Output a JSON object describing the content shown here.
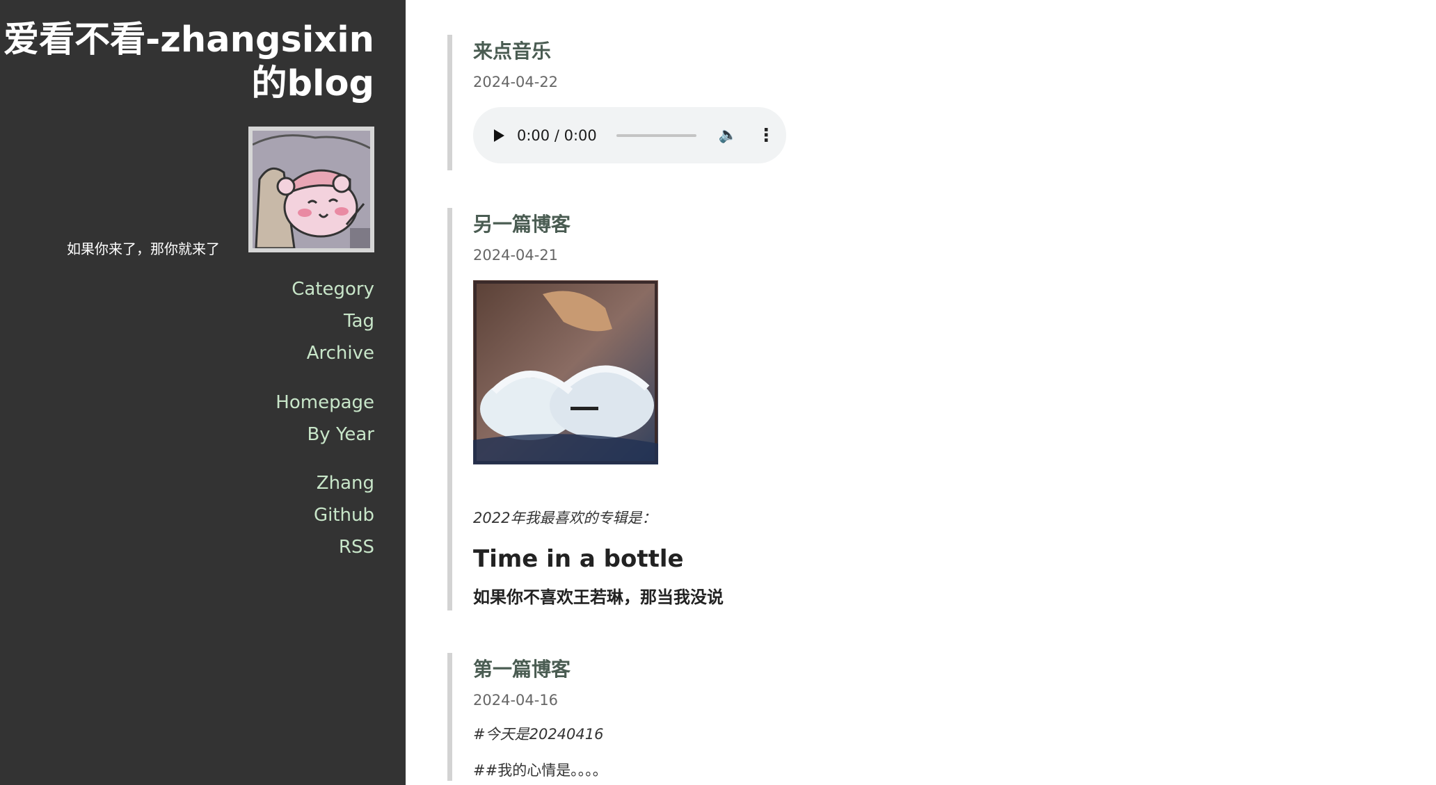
{
  "sidebar": {
    "site_title": "爱看不看-zhangsixin的blog",
    "motto": "如果你来了，那你就来了",
    "nav_primary": [
      "Category",
      "Tag",
      "Archive"
    ],
    "nav_secondary": [
      "Homepage",
      "By Year"
    ],
    "nav_links": [
      "Zhang",
      "Github",
      "RSS"
    ]
  },
  "posts": [
    {
      "title": "来点音乐",
      "date": "2024-04-22",
      "audio": {
        "time": "0:00 / 0:00"
      }
    },
    {
      "title": "另一篇博客",
      "date": "2024-04-21",
      "caption": "2022年我最喜欢的专辑是：",
      "heading": "Time in a bottle",
      "bold_line": "如果你不喜欢王若琳，那当我没说"
    },
    {
      "title": "第一篇博客",
      "date": "2024-04-16",
      "line1": "#今天是20240416",
      "line2": "##我的心情是。。。。"
    }
  ],
  "colors": {
    "sidebar_bg": "#333333",
    "nav_link": "#c8e6c9",
    "post_title": "#4a5c52",
    "post_border": "#d3d3d3"
  }
}
